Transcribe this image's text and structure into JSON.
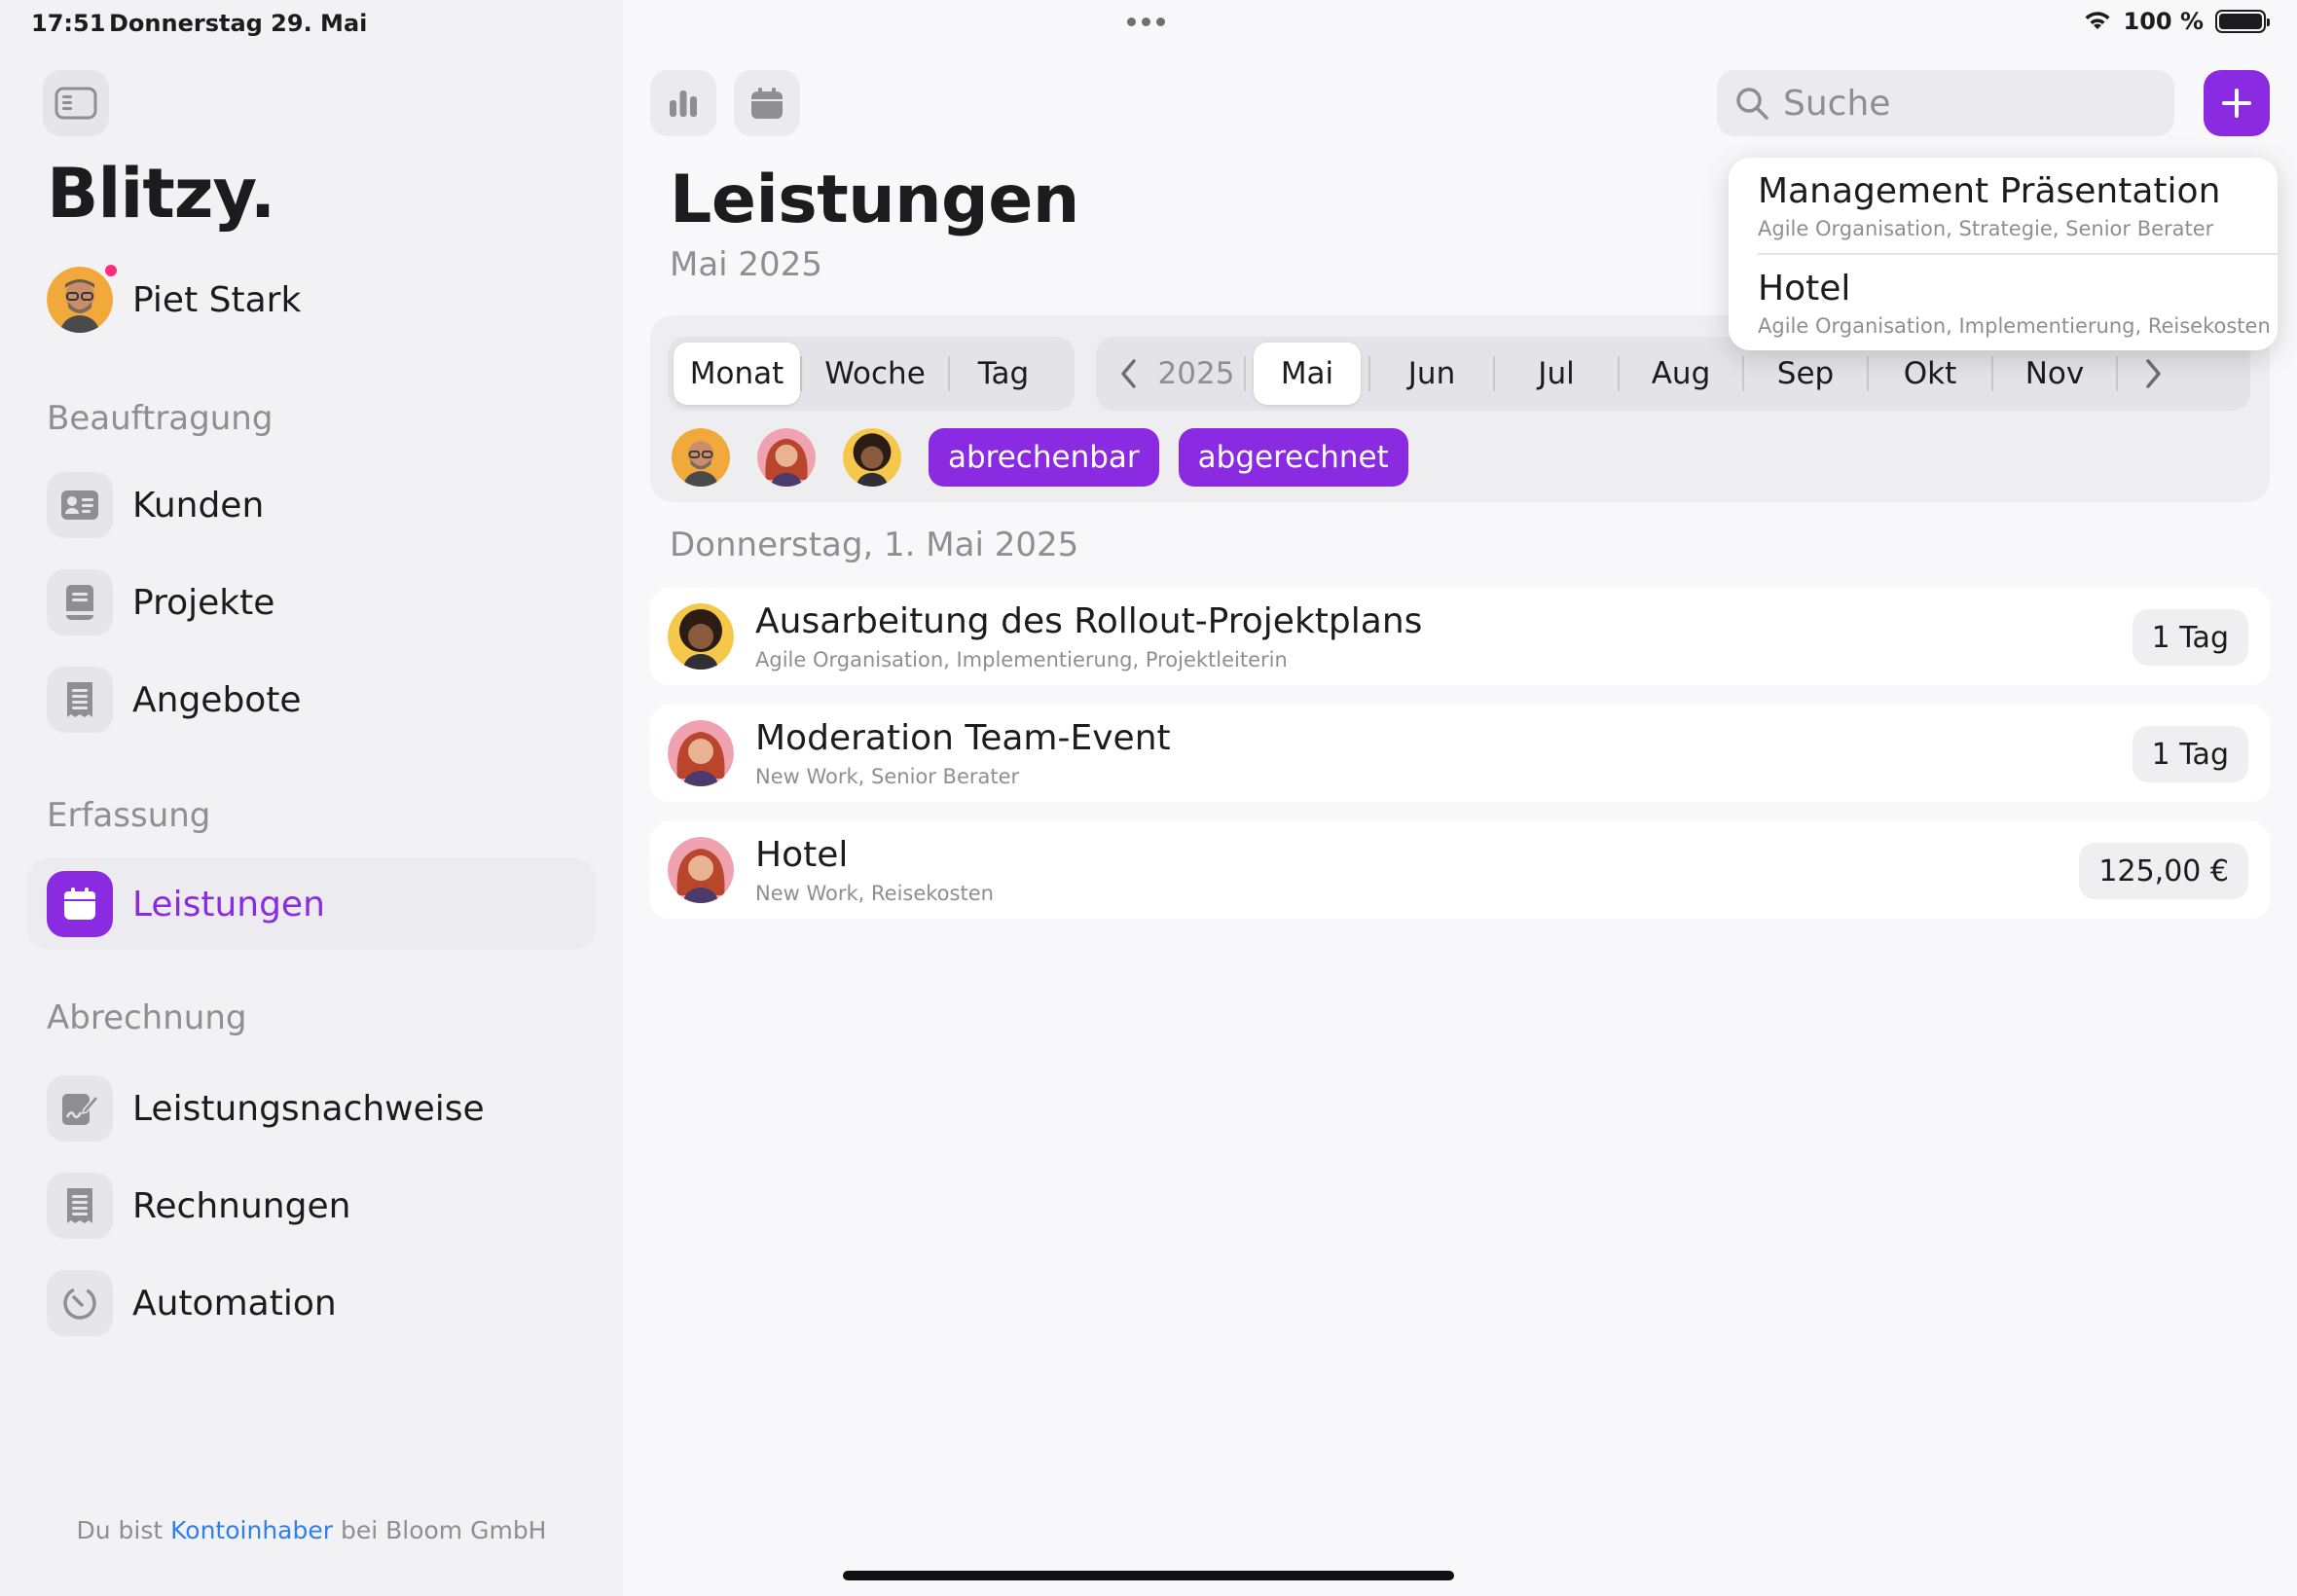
{
  "status_bar": {
    "time": "17:51",
    "date": "Donnerstag 29. Mai",
    "battery_text": "100 %"
  },
  "sidebar": {
    "app_name": "Blitzy.",
    "user_name": "Piet Stark",
    "sections": [
      {
        "title": "Beauftragung",
        "items": [
          {
            "label": "Kunden",
            "icon": "contact-card-icon"
          },
          {
            "label": "Projekte",
            "icon": "book-icon"
          },
          {
            "label": "Angebote",
            "icon": "document-list-icon"
          }
        ]
      },
      {
        "title": "Erfassung",
        "items": [
          {
            "label": "Leistungen",
            "icon": "calendar-icon"
          }
        ]
      },
      {
        "title": "Abrechnung",
        "items": [
          {
            "label": "Leistungsnachweise",
            "icon": "signed-document-icon"
          },
          {
            "label": "Rechnungen",
            "icon": "receipt-icon"
          },
          {
            "label": "Automation",
            "icon": "timer-icon"
          }
        ]
      }
    ],
    "account_note": {
      "prefix": "Du bist ",
      "link": "Kontoinhaber",
      "suffix": " bei Bloom GmbH"
    }
  },
  "main": {
    "search_placeholder": "Suche",
    "title": "Leistungen",
    "subtitle": "Mai 2025",
    "period_options": [
      "Monat",
      "Woche",
      "Tag"
    ],
    "selected_period": "Monat",
    "year": "2025",
    "months": [
      "Mai",
      "Jun",
      "Jul",
      "Aug",
      "Sep",
      "Okt",
      "Nov"
    ],
    "selected_month": "Mai",
    "filter_tags": [
      "abrechenbar",
      "abgerechnet"
    ],
    "day_header": "Donnerstag, 1. Mai 2025",
    "entries": [
      {
        "title": "Ausarbeitung des Rollout-Projektplans",
        "subtitle": "Agile Organisation, Implementierung, Projektleiterin",
        "badge": "1 Tag"
      },
      {
        "title": "Moderation Team-Event",
        "subtitle": "New Work, Senior Berater",
        "badge": "1 Tag"
      },
      {
        "title": "Hotel",
        "subtitle": "New Work, Reisekosten",
        "badge": "125,00 €"
      }
    ]
  },
  "dropdown": {
    "items": [
      {
        "title": "Management Präsentation",
        "subtitle": "Agile Organisation, Strategie, Senior Berater"
      },
      {
        "title": "Hotel",
        "subtitle": "Agile Organisation, Implementierung, Reisekosten"
      }
    ]
  },
  "colors": {
    "accent": "#8a2be2",
    "link": "#2f80ed",
    "presence": "#ff2d7a"
  }
}
